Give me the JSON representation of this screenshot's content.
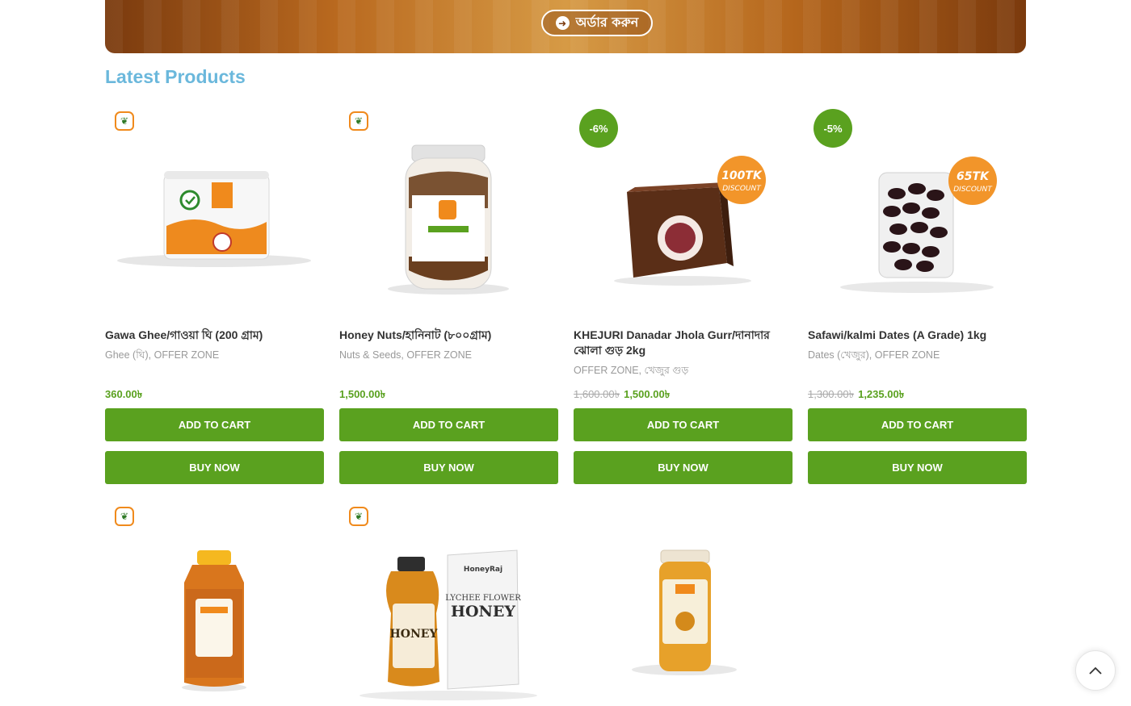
{
  "banner": {
    "order_label": "অর্ডার করুন"
  },
  "section": {
    "title": "Latest Products"
  },
  "common": {
    "add_to_cart": "ADD TO CART",
    "buy_now": "BUY NOW"
  },
  "products": [
    {
      "title": "Gawa Ghee/গাওয়া ঘি (200 গ্রাম)",
      "cats": "Ghee (ঘি), OFFER ZONE",
      "price": "360.00৳",
      "old_price": "",
      "badge": ""
    },
    {
      "title": "Honey Nuts/হানিনাট (৮০০গ্রাম)",
      "cats": "Nuts & Seeds, OFFER ZONE",
      "price": "1,500.00৳",
      "old_price": "",
      "badge": ""
    },
    {
      "title": "KHEJURI Danadar Jhola Gurr/দানাদার ঝোলা গুড় 2kg",
      "cats": "OFFER ZONE, খেজুর গুড়",
      "price": "1,500.00৳",
      "old_price": "1,600.00৳",
      "badge": "-6%",
      "sticker_top": "100TK",
      "sticker_bottom": "DISCOUNT"
    },
    {
      "title": "Safawi/kalmi Dates (A Grade) 1kg",
      "cats": "Dates (খেজুর), OFFER ZONE",
      "price": "1,235.00৳",
      "old_price": "1,300.00৳",
      "badge": "-5%",
      "sticker_top": "65TK",
      "sticker_bottom": "DISCOUNT"
    },
    {
      "badge": ""
    },
    {
      "badge": "",
      "label_brand": "HoneyRaj",
      "label_line1": "LYCHEE FLOWER",
      "label_line2": "HONEY"
    },
    {
      "badge": ""
    }
  ],
  "colors": {
    "accent": "#5aa11f",
    "title": "#6bb8dc",
    "badge_orange": "#f08a1c"
  }
}
